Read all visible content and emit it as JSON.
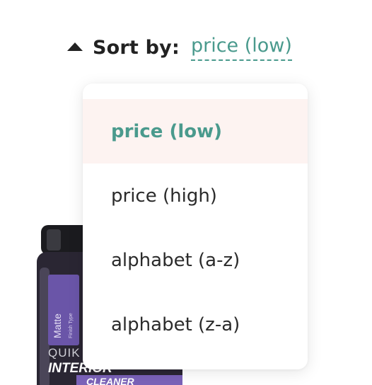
{
  "sort": {
    "label": "Sort by:",
    "current_value": "price (low)",
    "accent_color": "#4a9a8d",
    "toggle_icon": "caret-up-icon"
  },
  "dropdown": {
    "items": [
      {
        "label": "price (low)",
        "selected": true
      },
      {
        "label": "price (high)",
        "selected": false
      },
      {
        "label": "alphabet (a-z)",
        "selected": false
      },
      {
        "label": "alphabet (z-a)",
        "selected": false
      }
    ],
    "selected_background": "#fdf3f1"
  },
  "product": {
    "brand": "QUIK",
    "name_line1": "INTERIOR",
    "name_line2": "CLEANER",
    "finish_tag": "Matte",
    "finish_caption": "Finish Type"
  }
}
